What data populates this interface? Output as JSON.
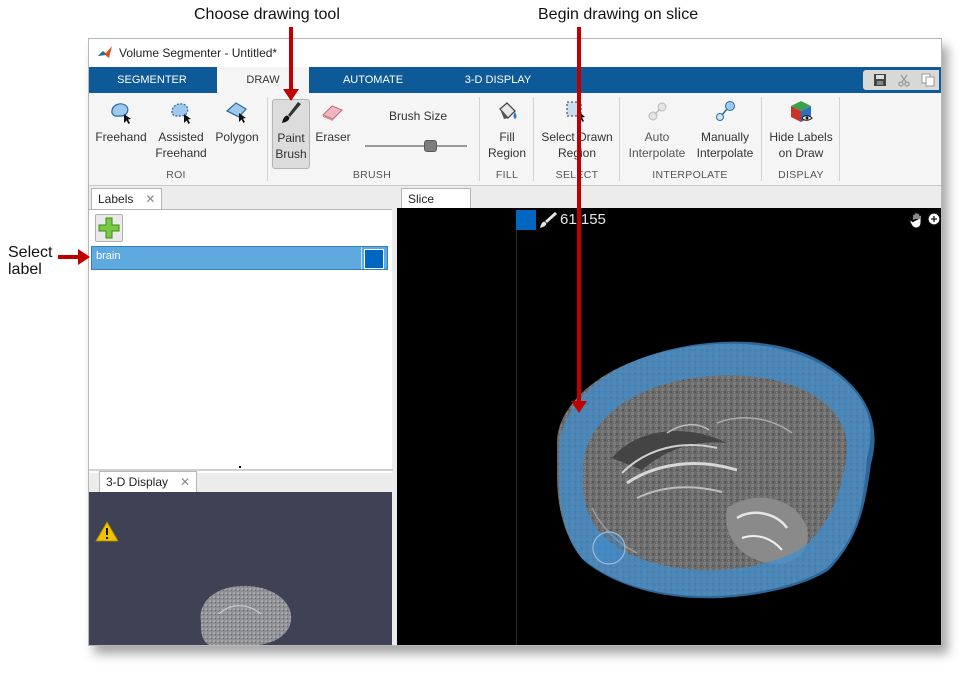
{
  "annotations": {
    "choose_tool": "Choose drawing tool",
    "begin_drawing": "Begin drawing on slice",
    "select_label_line1": "Select",
    "select_label_line2": "label"
  },
  "window": {
    "title": "Volume Segmenter - Untitled*"
  },
  "tabs": [
    {
      "label": "SEGMENTER"
    },
    {
      "label": "DRAW"
    },
    {
      "label": "AUTOMATE"
    },
    {
      "label": "3-D DISPLAY"
    }
  ],
  "ribbon": {
    "roi": {
      "freehand": "Freehand",
      "assisted_1": "Assisted",
      "assisted_2": "Freehand",
      "polygon": "Polygon",
      "group": "ROI"
    },
    "brush": {
      "paint_1": "Paint",
      "paint_2": "Brush",
      "eraser": "Eraser",
      "brush_size": "Brush Size",
      "group": "BRUSH",
      "brush_size_level": 0.66
    },
    "fill": {
      "fill_1": "Fill",
      "fill_2": "Region",
      "group": "FILL"
    },
    "select": {
      "select_1": "Select Drawn",
      "select_2": "Region",
      "group": "SELECT"
    },
    "interpolate": {
      "auto_1": "Auto",
      "auto_2": "Interpolate",
      "manual_1": "Manually",
      "manual_2": "Interpolate",
      "group": "INTERPOLATE"
    },
    "display": {
      "hide_1": "Hide Labels",
      "hide_2": "on Draw",
      "group": "DISPLAY"
    }
  },
  "panels": {
    "labels_tab": "Labels",
    "display_tab": "3-D Display",
    "slice_tab": "Slice"
  },
  "labels": [
    {
      "name": "brain",
      "color": "#0067c0"
    }
  ],
  "slice": {
    "number": "61/155"
  },
  "colors": {
    "accent_tab": "#0e5a98",
    "label_blue": "#0067c0",
    "overlay_blue": "#3d8fd1",
    "annotation_arrow": "#c00000"
  }
}
